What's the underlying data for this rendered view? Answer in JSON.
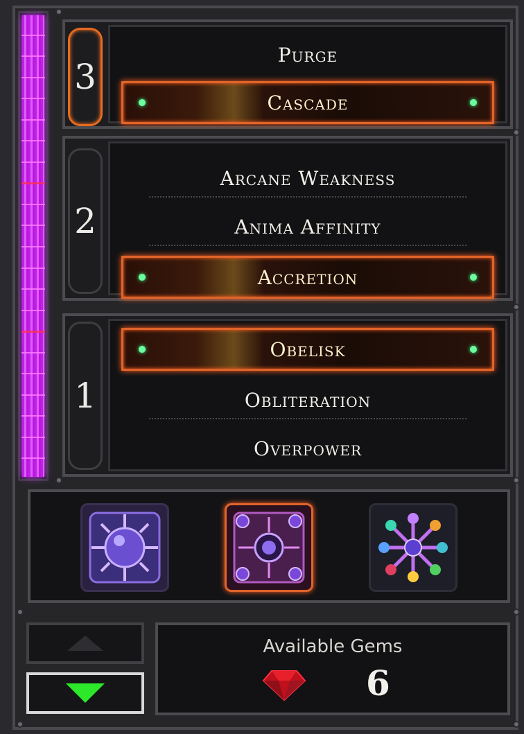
{
  "progress": {
    "fill_fraction": 1.0
  },
  "tiers": [
    {
      "number": "3",
      "active": true,
      "nodes": [
        {
          "label": "Purge",
          "selected": false
        },
        {
          "label": "Cascade",
          "selected": true
        }
      ]
    },
    {
      "number": "2",
      "active": false,
      "nodes": [
        {
          "label": "Arcane Weakness",
          "selected": false
        },
        {
          "label": "Anima Affinity",
          "selected": false
        },
        {
          "label": "Accretion",
          "selected": true
        }
      ]
    },
    {
      "number": "1",
      "active": false,
      "nodes": [
        {
          "label": "Obelisk",
          "selected": true
        },
        {
          "label": "Obliteration",
          "selected": false
        },
        {
          "label": "Overpower",
          "selected": false
        }
      ]
    }
  ],
  "skill_icons": [
    "sun-orb-icon",
    "rune-orb-icon",
    "gem-constellation-icon"
  ],
  "skill_selected_index": 1,
  "gems": {
    "label": "Available Gems",
    "count": "6",
    "icon": "ruby-gem-icon"
  },
  "scroll": {
    "up_icon": "triangle-up-icon",
    "down_icon": "triangle-down-icon"
  },
  "colors": {
    "accent": "#e0642a",
    "progress": "#d040ff",
    "down_arrow": "#2de82a"
  }
}
